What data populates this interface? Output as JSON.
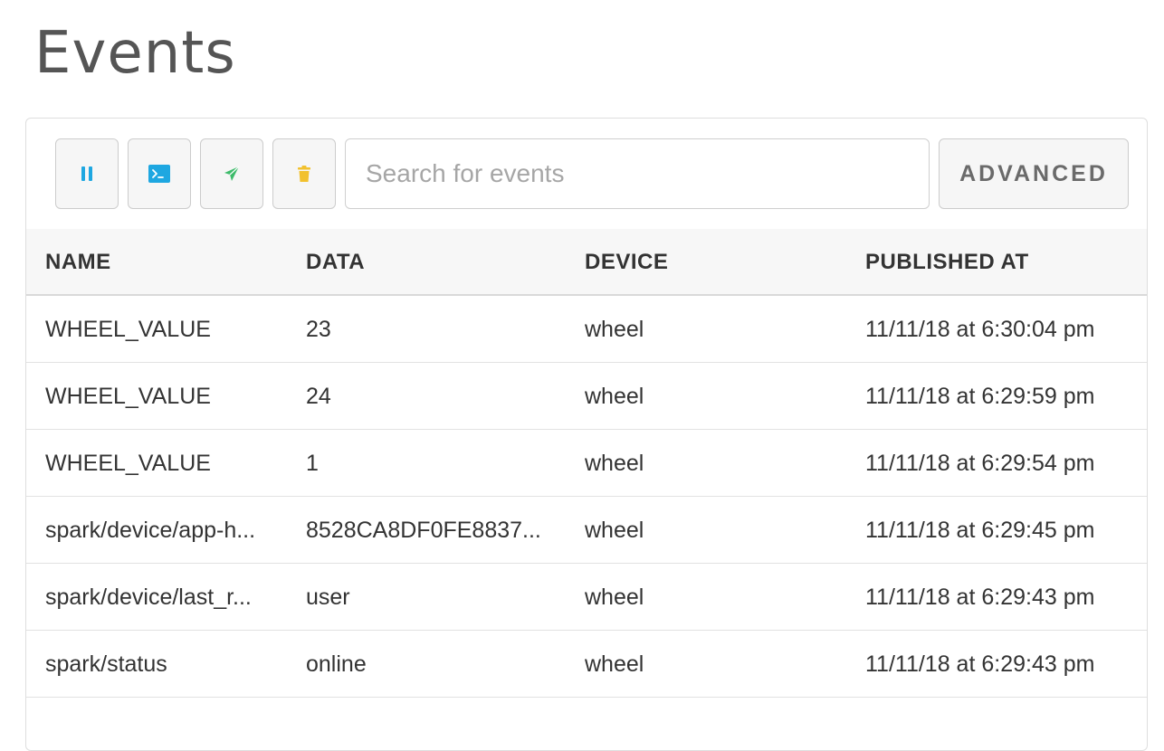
{
  "page": {
    "title": "Events"
  },
  "toolbar": {
    "buttons": [
      {
        "name": "pause",
        "icon": "pause-icon",
        "color": "#1ea7e1"
      },
      {
        "name": "console",
        "icon": "terminal-icon",
        "color": "#1ea7e1"
      },
      {
        "name": "publish",
        "icon": "send-icon",
        "color": "#3dbb6a"
      },
      {
        "name": "clear",
        "icon": "trash-icon",
        "color": "#f2c12e"
      }
    ],
    "search": {
      "value": "",
      "placeholder": "Search for events"
    },
    "advanced_label": "ADVANCED"
  },
  "table": {
    "columns": [
      "NAME",
      "DATA",
      "DEVICE",
      "PUBLISHED AT"
    ],
    "rows": [
      {
        "name": "WHEEL_VALUE",
        "data": "23",
        "device": "wheel",
        "published": "11/11/18 at 6:30:04 pm"
      },
      {
        "name": "WHEEL_VALUE",
        "data": "24",
        "device": "wheel",
        "published": "11/11/18 at 6:29:59 pm"
      },
      {
        "name": "WHEEL_VALUE",
        "data": "1",
        "device": "wheel",
        "published": "11/11/18 at 6:29:54 pm"
      },
      {
        "name": "spark/device/app-h...",
        "data": "8528CA8DF0FE8837...",
        "device": "wheel",
        "published": "11/11/18 at 6:29:45 pm"
      },
      {
        "name": "spark/device/last_r...",
        "data": "user",
        "device": "wheel",
        "published": "11/11/18 at 6:29:43 pm"
      },
      {
        "name": "spark/status",
        "data": "online",
        "device": "wheel",
        "published": "11/11/18 at 6:29:43 pm"
      }
    ]
  }
}
